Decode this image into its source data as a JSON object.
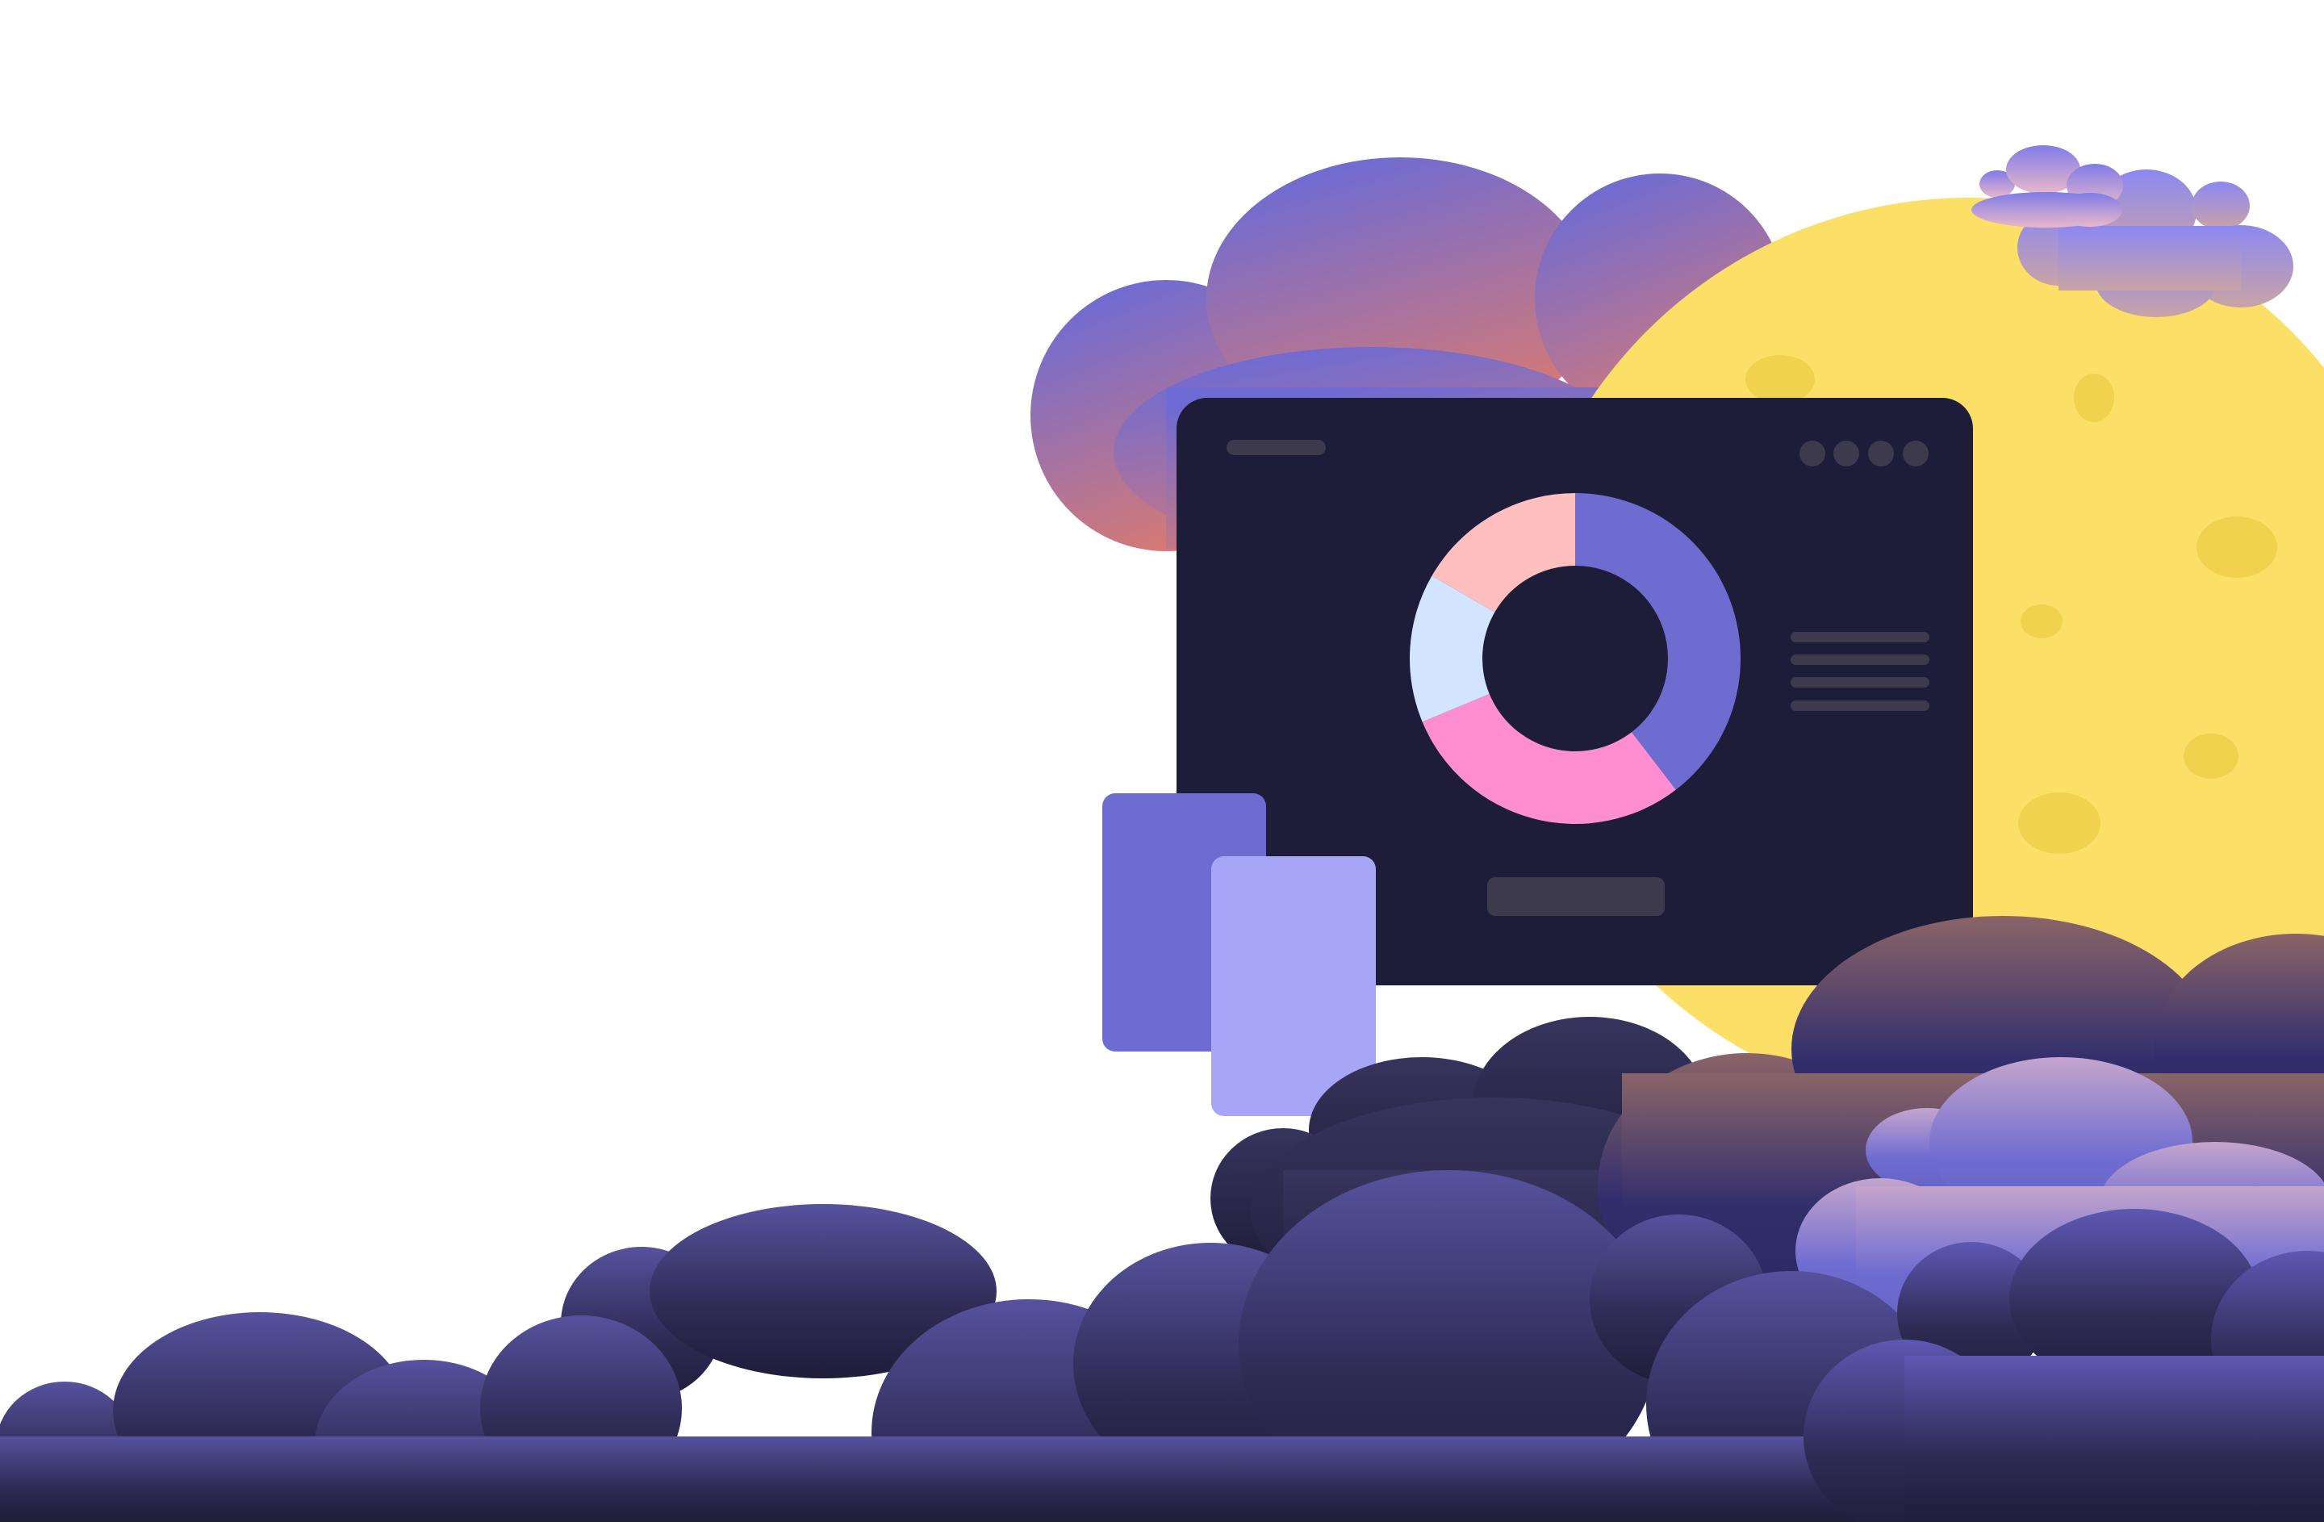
{
  "colors": {
    "background": "#ffffff",
    "moon": "#FCDF67",
    "crater": "#F0D24E",
    "window_bg": "#1E1D39",
    "placeholder_bar": "#3C3A4C",
    "slice_purple": "#6F6CD1",
    "slice_pink": "#FF8ED1",
    "slice_light_blue": "#D2E4FF",
    "slice_peach": "#FEBFBE",
    "card_back": "#6F6CD1",
    "card_front": "#A7A5F6",
    "cloud_top_start": "#6E6BD4",
    "cloud_top_end": "#D97C77",
    "cloud_dark_top": "#56529E",
    "cloud_dark_bottom": "#1F1D39"
  },
  "chart_data": {
    "type": "pie",
    "values": [
      38,
      28,
      14,
      16
    ],
    "colors": [
      "#6F6CD1",
      "#FF8ED1",
      "#D2E4FF",
      "#FEBFBE"
    ]
  },
  "icons": {
    "window_controls": [
      "dot-icon",
      "dot-icon",
      "dot-icon",
      "dot-icon"
    ]
  }
}
